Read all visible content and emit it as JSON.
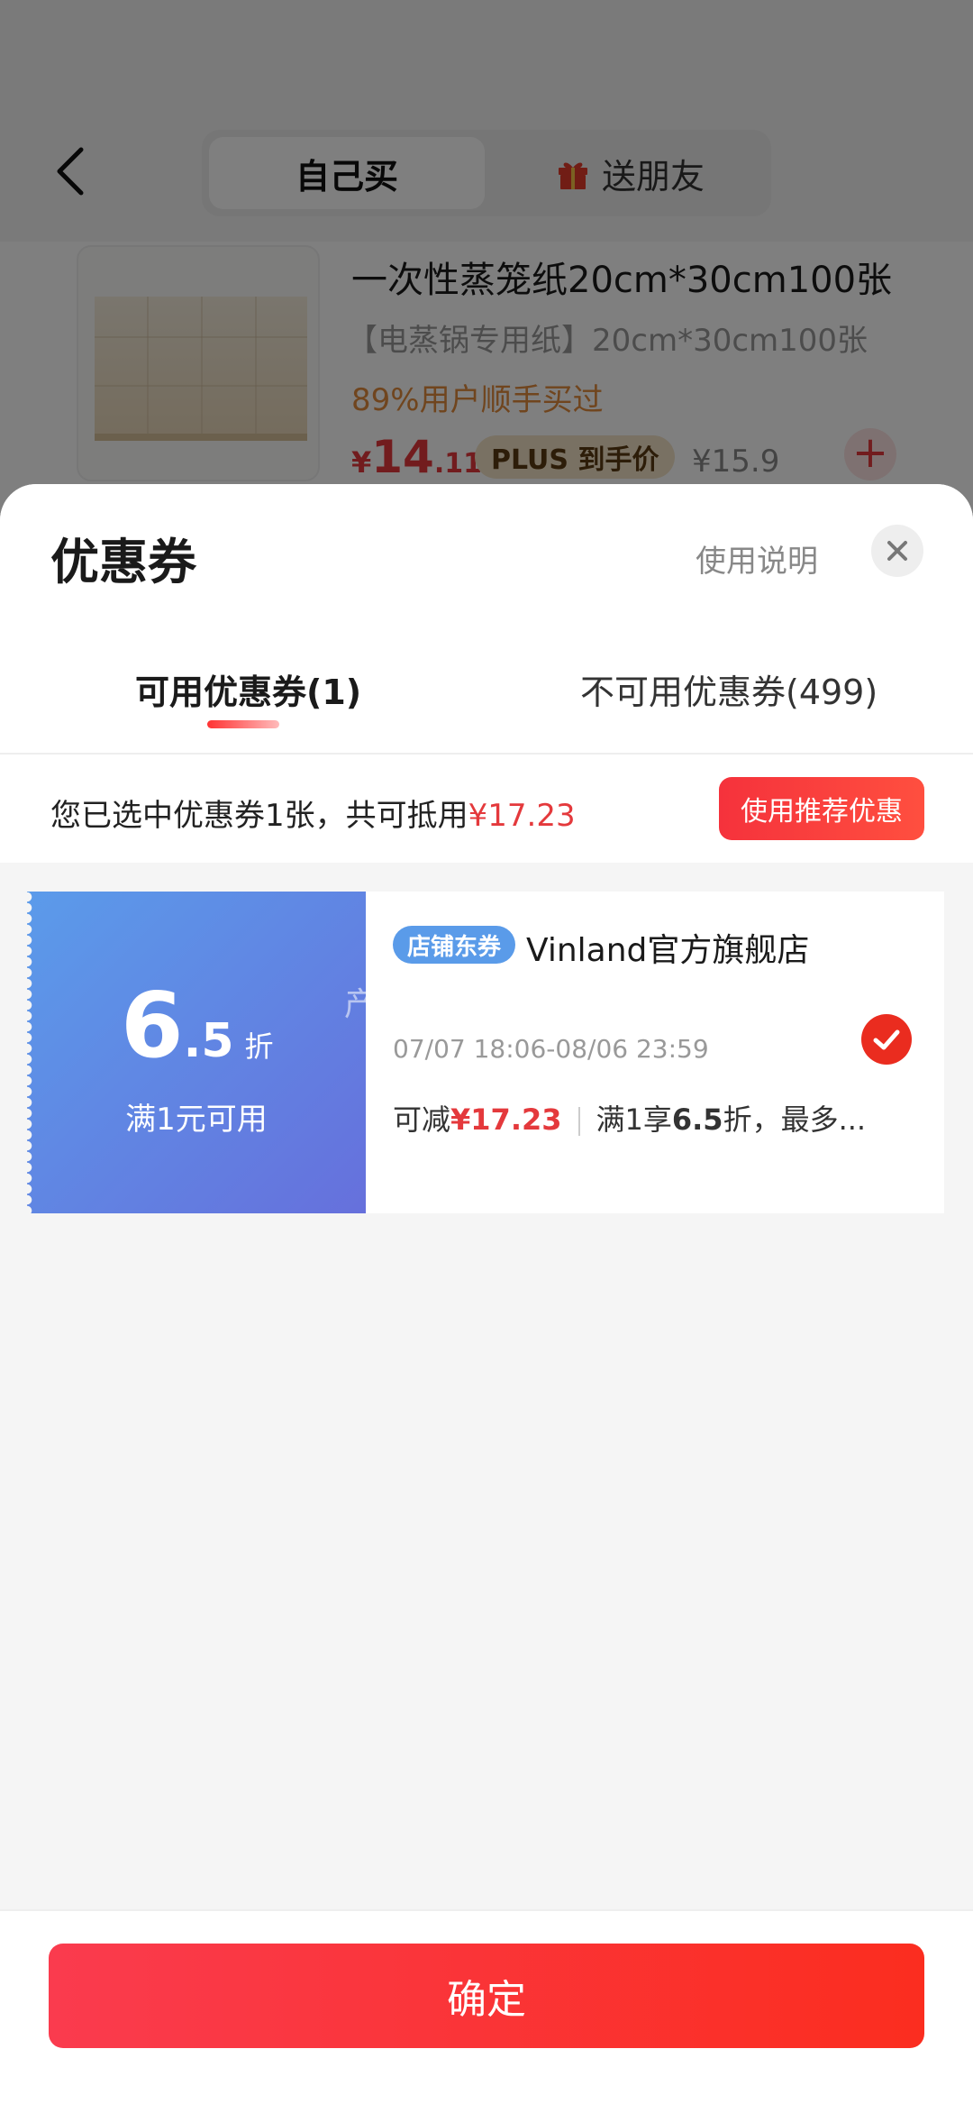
{
  "background": {
    "nav": {
      "segment_self": "自己买",
      "segment_friend": "送朋友"
    },
    "product": {
      "title": "一次性蒸笼纸20cm*30cm100张",
      "subtitle": "【电蒸锅专用纸】20cm*30cm100张",
      "tag": "89%用户顺手买过",
      "price_symbol": "¥",
      "price_int": "14",
      "price_dec": ".11",
      "plus_badge": "PLUS 到手价",
      "original_price": "¥15.9",
      "add_label": "+"
    }
  },
  "sheet": {
    "title": "优惠券",
    "help": "使用说明",
    "tabs": [
      {
        "label": "可用优惠券(1)",
        "active": true
      },
      {
        "label": "不可用优惠券(499)",
        "active": false
      }
    ],
    "summary": {
      "text": "您已选中优惠券1张，共可抵用",
      "amount": "¥17.23",
      "recommend_button": "使用推荐优惠"
    },
    "coupons": [
      {
        "discount_int": "6",
        "discount_dec": ".5",
        "discount_unit": "折",
        "threshold": "满1元可用",
        "badge": "店铺东券",
        "store": "Vinland官方旗舰店",
        "validity": "07/07 18:06-08/06 23:59",
        "save_prefix": "可减",
        "save_amount": "¥17.23",
        "rule_prefix": "满1享",
        "rule_value": "6.5",
        "rule_suffix": "折，最多...",
        "selected": true
      }
    ],
    "watermark": "产品性能优势",
    "confirm_button": "确定"
  },
  "colors": {
    "accent_red": "#e4393c",
    "coupon_blue_start": "#5b9bea",
    "coupon_blue_end": "#6670dc",
    "plus_gold": "#f3e3c6"
  },
  "icons": {
    "back": "chevron-left-icon",
    "gift": "gift-icon",
    "close": "close-icon",
    "check": "check-circle-icon"
  }
}
